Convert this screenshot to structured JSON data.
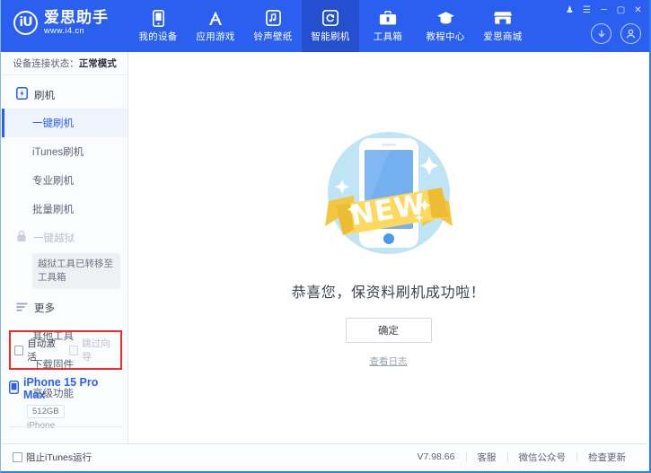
{
  "header": {
    "logo_mark": "iU",
    "logo_name": "爱思助手",
    "logo_url": "www.i4.cn",
    "nav": [
      {
        "label": "我的设备",
        "icon": "phone-icon",
        "active": false
      },
      {
        "label": "应用游戏",
        "icon": "appstore-icon",
        "active": false
      },
      {
        "label": "铃声壁纸",
        "icon": "music-icon",
        "active": false
      },
      {
        "label": "智能刷机",
        "icon": "refresh-icon",
        "active": true
      },
      {
        "label": "工具箱",
        "icon": "toolbox-icon",
        "active": false
      },
      {
        "label": "教程中心",
        "icon": "graduation-cap-icon",
        "active": false
      },
      {
        "label": "爱思商城",
        "icon": "shop-icon",
        "active": false
      }
    ],
    "window_buttons": [
      {
        "name": "skin-icon",
        "glyph": "♟"
      },
      {
        "name": "menu-icon",
        "glyph": "☰"
      },
      {
        "name": "minimize-icon",
        "glyph": "─"
      },
      {
        "name": "maximize-icon",
        "glyph": "▢"
      },
      {
        "name": "close-icon",
        "glyph": "✕"
      }
    ],
    "account_buttons": [
      {
        "name": "download-icon"
      },
      {
        "name": "user-avatar-icon"
      }
    ]
  },
  "sidebar": {
    "connection_label": "设备连接状态：",
    "connection_value": "正常模式",
    "groups": [
      {
        "title": "刷机",
        "icon": "flash-phone-icon",
        "locked": false,
        "items": [
          {
            "label": "一键刷机",
            "active": true,
            "disabled": false
          },
          {
            "label": "iTunes刷机",
            "active": false,
            "disabled": false
          },
          {
            "label": "专业刷机",
            "active": false,
            "disabled": false
          },
          {
            "label": "批量刷机",
            "active": false,
            "disabled": false
          }
        ]
      },
      {
        "title": "一键越狱",
        "icon": "lock-icon",
        "locked": true,
        "tip": "越狱工具已转移至工具箱",
        "items": []
      },
      {
        "title": "更多",
        "icon": "list-icon",
        "locked": false,
        "items": [
          {
            "label": "其他工具",
            "active": false,
            "disabled": false
          },
          {
            "label": "下载固件",
            "active": false,
            "disabled": false
          },
          {
            "label": "高级功能",
            "active": false,
            "disabled": false
          }
        ]
      }
    ],
    "options": [
      {
        "label": "自动激活",
        "checked": false,
        "disabled": false
      },
      {
        "label": "跳过向导",
        "checked": false,
        "disabled": true
      }
    ],
    "options_highlight_color": "#ee2b2b",
    "device": {
      "name": "iPhone 15 Pro Max",
      "capacity": "512GB",
      "type": "iPhone",
      "icon": "phone-icon",
      "accent": "#2a5ff0"
    }
  },
  "main": {
    "illustration": "new-phone-badge-illustration",
    "result_text": "恭喜您，保资料刷机成功啦！",
    "confirm_button": "确定",
    "log_link": "查看日志"
  },
  "statusbar": {
    "block_itunes": {
      "label": "阻止iTunes运行",
      "checked": false
    },
    "version": "V7.98.66",
    "links": [
      {
        "label": "客服"
      },
      {
        "label": "微信公众号"
      },
      {
        "label": "检查更新"
      }
    ]
  }
}
